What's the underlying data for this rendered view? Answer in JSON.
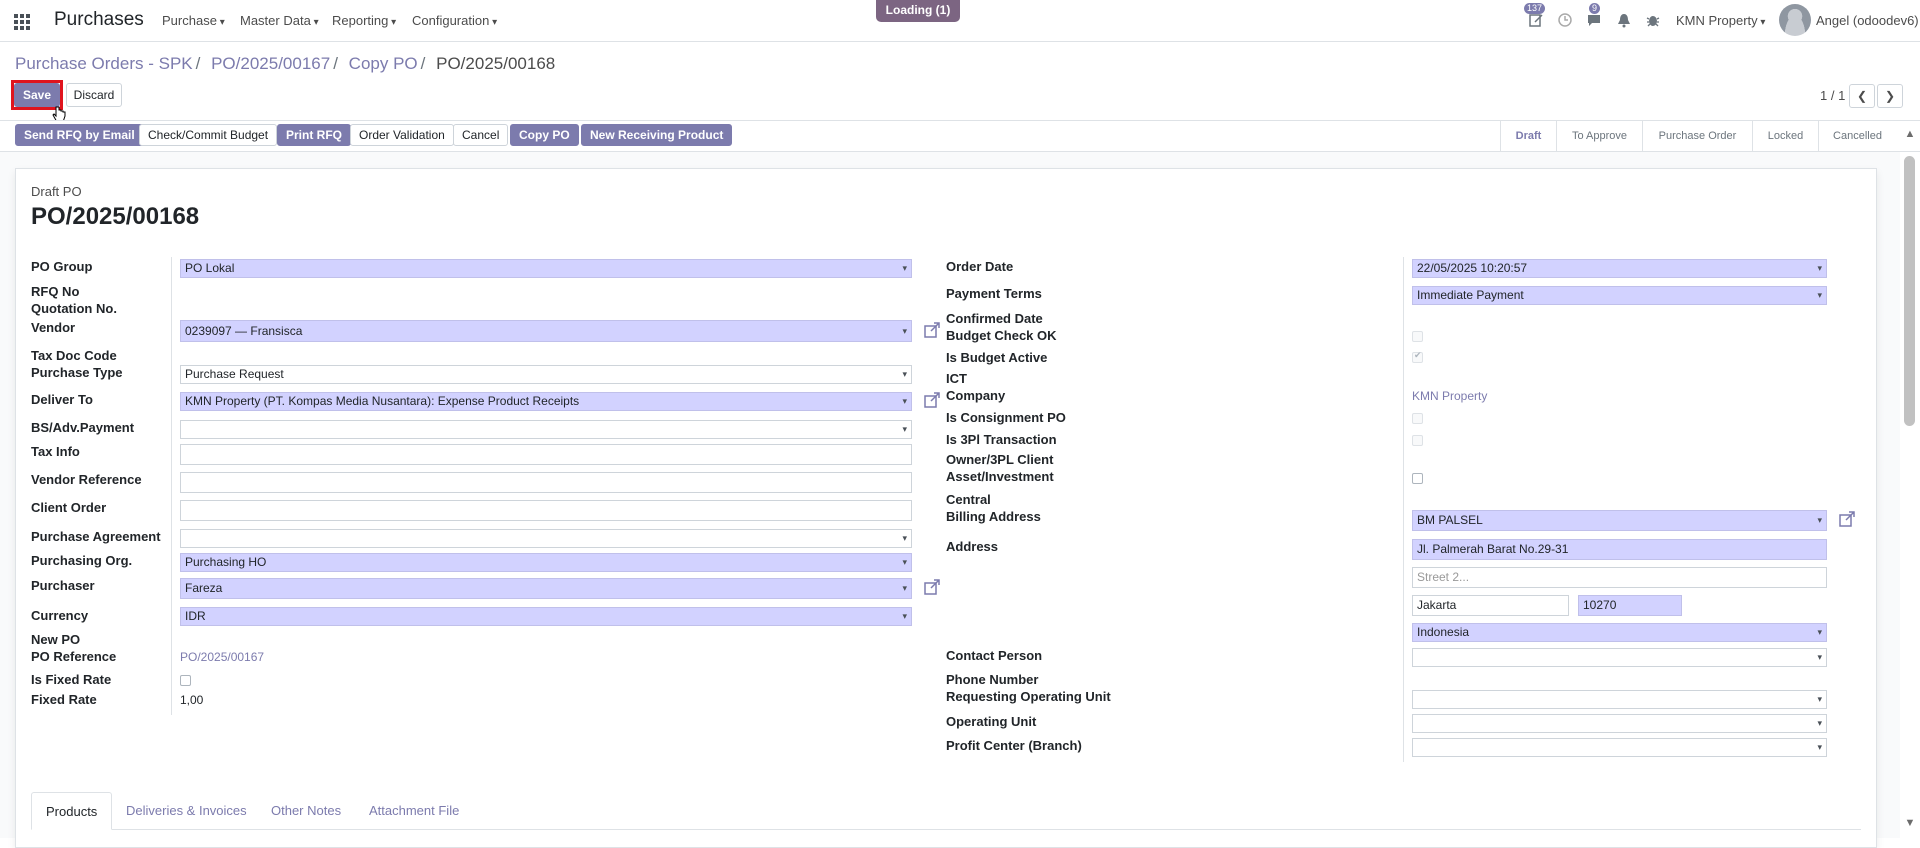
{
  "nav": {
    "app_title": "Purchases",
    "menus": [
      "Purchase",
      "Master Data",
      "Reporting",
      "Configuration"
    ],
    "loading": "Loading (1)",
    "activity_count": "137",
    "message_count": "9",
    "company": "KMN Property",
    "user": "Angel (odoodev6)"
  },
  "breadcrumb": {
    "items": [
      "Purchase Orders - SPK",
      "PO/2025/00167",
      "Copy PO"
    ],
    "current": "PO/2025/00168"
  },
  "actions": {
    "save": "Save",
    "discard": "Discard"
  },
  "pager": {
    "value": "1 / 1"
  },
  "header_buttons": {
    "send_rfq": "Send RFQ by Email",
    "check_budget": "Check/Commit Budget",
    "print_rfq": "Print RFQ",
    "order_validation": "Order Validation",
    "cancel": "Cancel",
    "copy_po": "Copy PO",
    "new_receiving": "New Receiving Product"
  },
  "stages": [
    "Draft",
    "To Approve",
    "Purchase Order",
    "Locked",
    "Cancelled"
  ],
  "active_stage": "Draft",
  "form": {
    "doc_type": "Draft PO",
    "name": "PO/2025/00168",
    "left": {
      "po_group": {
        "label": "PO Group",
        "value": "PO Lokal"
      },
      "rfq_no": {
        "label": "RFQ No"
      },
      "quotation_no": {
        "label": "Quotation No."
      },
      "vendor": {
        "label": "Vendor",
        "value": "0239097 — Fransisca"
      },
      "tax_doc_code": {
        "label": "Tax Doc Code"
      },
      "purchase_type": {
        "label": "Purchase Type",
        "value": "Purchase Request"
      },
      "deliver_to": {
        "label": "Deliver To",
        "value": "KMN Property (PT. Kompas Media Nusantara): Expense Product Receipts"
      },
      "bs_adv_payment": {
        "label": "BS/Adv.Payment",
        "value": ""
      },
      "tax_info": {
        "label": "Tax Info",
        "value": ""
      },
      "vendor_reference": {
        "label": "Vendor Reference",
        "value": ""
      },
      "client_order": {
        "label": "Client Order",
        "value": ""
      },
      "purchase_agreement": {
        "label": "Purchase Agreement",
        "value": ""
      },
      "purchasing_org": {
        "label": "Purchasing Org.",
        "value": "Purchasing HO"
      },
      "purchaser": {
        "label": "Purchaser",
        "value": "Fareza"
      },
      "currency": {
        "label": "Currency",
        "value": "IDR"
      },
      "new_po": {
        "label": "New PO"
      },
      "po_reference": {
        "label": "PO Reference",
        "value": "PO/2025/00167"
      },
      "is_fixed_rate": {
        "label": "Is Fixed Rate",
        "checked": false
      },
      "fixed_rate": {
        "label": "Fixed Rate",
        "value": "1,00"
      }
    },
    "right": {
      "order_date": {
        "label": "Order Date",
        "value": "22/05/2025 10:20:57"
      },
      "payment_terms": {
        "label": "Payment Terms",
        "value": "Immediate Payment"
      },
      "confirmed_date": {
        "label": "Confirmed Date"
      },
      "budget_check_ok": {
        "label": "Budget Check OK",
        "checked": false
      },
      "is_budget_active": {
        "label": "Is Budget Active",
        "checked": true
      },
      "ict": {
        "label": "ICT"
      },
      "company": {
        "label": "Company",
        "value": "KMN Property"
      },
      "is_consignment_po": {
        "label": "Is Consignment PO",
        "checked": false
      },
      "is_3pl_transaction": {
        "label": "Is 3Pl Transaction",
        "checked": false
      },
      "owner_3pl_client": {
        "label": "Owner/3PL Client"
      },
      "asset_investment": {
        "label": "Asset/Investment",
        "checked": false
      },
      "central": {
        "label": "Central"
      },
      "billing_address": {
        "label": "Billing Address",
        "value": "BM PALSEL"
      },
      "address": {
        "label": "Address",
        "street": "Jl. Palmerah Barat No.29-31",
        "street2_placeholder": "Street 2...",
        "city": "Jakarta",
        "zip": "10270",
        "country": "Indonesia"
      },
      "contact_person": {
        "label": "Contact Person",
        "value": ""
      },
      "phone_number": {
        "label": "Phone Number"
      },
      "requesting_operating_unit": {
        "label": "Requesting Operating Unit",
        "value": ""
      },
      "operating_unit": {
        "label": "Operating Unit",
        "value": ""
      },
      "profit_center": {
        "label": "Profit Center (Branch)",
        "value": ""
      }
    }
  },
  "tabs": [
    "Products",
    "Deliveries & Invoices",
    "Other Notes",
    "Attachment File"
  ],
  "colors": {
    "primary": "#7c7bad",
    "required_bg": "#d2d2ff",
    "highlight": "#e0141e",
    "loading": "#7c6582"
  }
}
